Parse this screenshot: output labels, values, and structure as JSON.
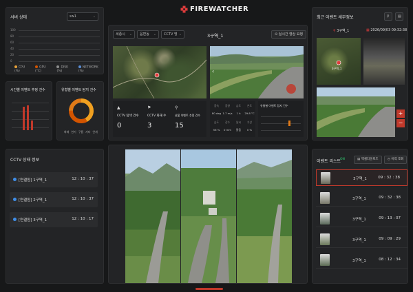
{
  "app": {
    "logo_text": "FIREWATCHER"
  },
  "server": {
    "title": "서버 상태",
    "select": "sw1",
    "y_ticks": [
      "100",
      "80",
      "60",
      "40",
      "20",
      "0"
    ],
    "legend": [
      {
        "label": "CPU (%)",
        "color": "#e8a23a"
      },
      {
        "label": "GPU (°C)",
        "color": "#d35400"
      },
      {
        "label": "DISK (%)",
        "color": "#8e8e8e"
      },
      {
        "label": "NETWORK (%)",
        "color": "#5a8dd6"
      }
    ]
  },
  "hourly": {
    "title": "시간별 이벤트 추정 건수",
    "bars": [
      0.85,
      0.9,
      0.35
    ]
  },
  "typeStats": {
    "title": "유형별 이벤트 탐지 건수",
    "legend": [
      "화재",
      "연기",
      "구름",
      "기타",
      "안개"
    ],
    "ring": [
      {
        "value": 0.42,
        "color": "#f0a020"
      },
      {
        "value": 0.33,
        "color": "#d35400"
      },
      {
        "value": 0.25,
        "color": "#e07a18"
      }
    ]
  },
  "main": {
    "filters": [
      "세종시",
      "읍면동",
      "CCTV 명"
    ],
    "title": "3구역_1",
    "realtime_btn": "실시간 영상 요청",
    "stats": [
      {
        "label": "CCTV 탐색 건수",
        "value": "0",
        "icon": "triangle-icon"
      },
      {
        "label": "CCTV 화재 수",
        "value": "3",
        "icon": "flag-icon"
      },
      {
        "label": "산불 이벤트 추정 건수",
        "value": "15",
        "icon": "pin-icon"
      }
    ],
    "weather": [
      {
        "label": "풍속",
        "value": "80 deg"
      },
      {
        "label": "풍향",
        "value": "1.7 m/s"
      },
      {
        "label": "습도",
        "value": "1 h"
      },
      {
        "label": "온도",
        "value": "29.8 °C"
      },
      {
        "label": "습도",
        "value": "56 %"
      },
      {
        "label": "강수",
        "value": "0 mm"
      },
      {
        "label": "날씨",
        "value": "맑음"
      },
      {
        "label": "기상",
        "value": "0 %"
      }
    ],
    "chart_title": "유형별 이벤트 탐지 건수"
  },
  "cctv": {
    "title": "CCTV 상태 정보",
    "items": [
      {
        "name": "[연결됨] 1구역_1",
        "time": "12 : 10 : 37"
      },
      {
        "name": "[연결됨] 2구역_1",
        "time": "12 : 10 : 37"
      },
      {
        "name": "[연결됨] 3구역_1",
        "time": "12 : 10 : 17"
      }
    ]
  },
  "detail": {
    "title": "최근 이벤트 세부정보",
    "location": "3구역_1",
    "datetime": "2026/09/03 09:32:38",
    "map_label": "3구역_1"
  },
  "events": {
    "title": "이벤트 리스트",
    "badge": "ON",
    "btn1": "엑셀다운로드",
    "btn2": "이력 조회",
    "rows": [
      {
        "location": "3구역_1",
        "time": "09 : 32 : 38"
      },
      {
        "location": "3구역_1",
        "time": "09 : 32 : 38"
      },
      {
        "location": "3구역_1",
        "time": "09 : 13 : 07"
      },
      {
        "location": "3구역_1",
        "time": "09 : 09 : 29"
      },
      {
        "location": "3구역_1",
        "time": "08 : 12 : 34"
      }
    ]
  }
}
